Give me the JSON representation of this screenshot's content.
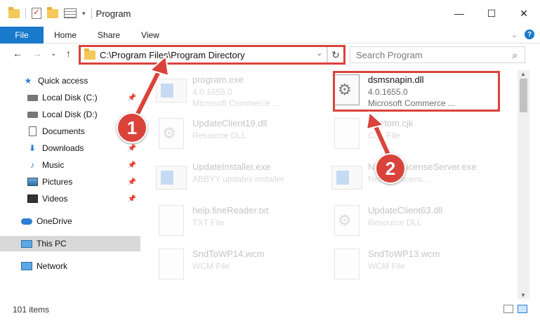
{
  "window": {
    "title": "Program",
    "minimize": "—",
    "maximize": "☐",
    "close": "✕"
  },
  "ribbon": {
    "file_tab": "File",
    "tabs": [
      "Home",
      "Share",
      "View"
    ],
    "help": "?"
  },
  "nav": {
    "back": "←",
    "forward": "→",
    "recent": "⌄",
    "up": "↑",
    "address": "C:\\Program Files\\Program Directory",
    "address_dropdown": "⌄",
    "refresh": "↻",
    "search_placeholder": "Search Program",
    "search_icon": "⌕"
  },
  "sidebar": {
    "items": [
      {
        "label": "Quick access",
        "icon": "star-icon",
        "pinned": false
      },
      {
        "label": "Local Disk (C:)",
        "icon": "drive-icon",
        "pinned": true
      },
      {
        "label": "Local Disk (D:)",
        "icon": "drive-icon",
        "pinned": false
      },
      {
        "label": "Documents",
        "icon": "document-icon",
        "pinned": true
      },
      {
        "label": "Downloads",
        "icon": "download-icon",
        "pinned": true
      },
      {
        "label": "Music",
        "icon": "music-icon",
        "pinned": true
      },
      {
        "label": "Pictures",
        "icon": "pictures-icon",
        "pinned": true
      },
      {
        "label": "Videos",
        "icon": "videos-icon",
        "pinned": true
      },
      {
        "label": "OneDrive",
        "icon": "cloud-icon",
        "pinned": false
      },
      {
        "label": "This PC",
        "icon": "pc-icon",
        "pinned": false,
        "selected": true
      },
      {
        "label": "Network",
        "icon": "network-icon",
        "pinned": false
      }
    ],
    "pin_glyph": "📌"
  },
  "files": [
    {
      "name": "program.exe",
      "line2": "4.0.1655.0",
      "line3": "Microsoft Commerce ...",
      "icon": "exe-icon"
    },
    {
      "name": "dsmsnapin.dll",
      "line2": "4.0.1655.0",
      "line3": "Microsoft Commerce ...",
      "icon": "dll-icon",
      "highlighted": true
    },
    {
      "name": "UpdateClient19.dll",
      "line2": "Resource DLL",
      "line3": "",
      "icon": "dll-icon"
    },
    {
      "name": "Custom.cjk",
      "line2": "CJK File",
      "line3": "",
      "icon": "file-icon"
    },
    {
      "name": "UpdateInstaller.exe",
      "line2": "ABBYY updates installer",
      "line3": "",
      "icon": "exe-icon"
    },
    {
      "name": "NetworkLicenseServer.exe",
      "line2": "Network licens...",
      "line3": "",
      "icon": "exe-icon"
    },
    {
      "name": "help.fineReader.txt",
      "line2": "TXT File",
      "line3": "",
      "icon": "file-icon"
    },
    {
      "name": "UpdateClient63.dll",
      "line2": "Resource DLL",
      "line3": "",
      "icon": "dll-icon"
    },
    {
      "name": "SndToWP14.wcm",
      "line2": "WCM File",
      "line3": "",
      "icon": "file-icon"
    },
    {
      "name": "SndToWP13.wcm",
      "line2": "WCM File",
      "line3": "",
      "icon": "file-icon"
    }
  ],
  "status": {
    "item_count": "101 items"
  },
  "annotations": {
    "step1": "1",
    "step2": "2",
    "color": "#d9433b"
  }
}
